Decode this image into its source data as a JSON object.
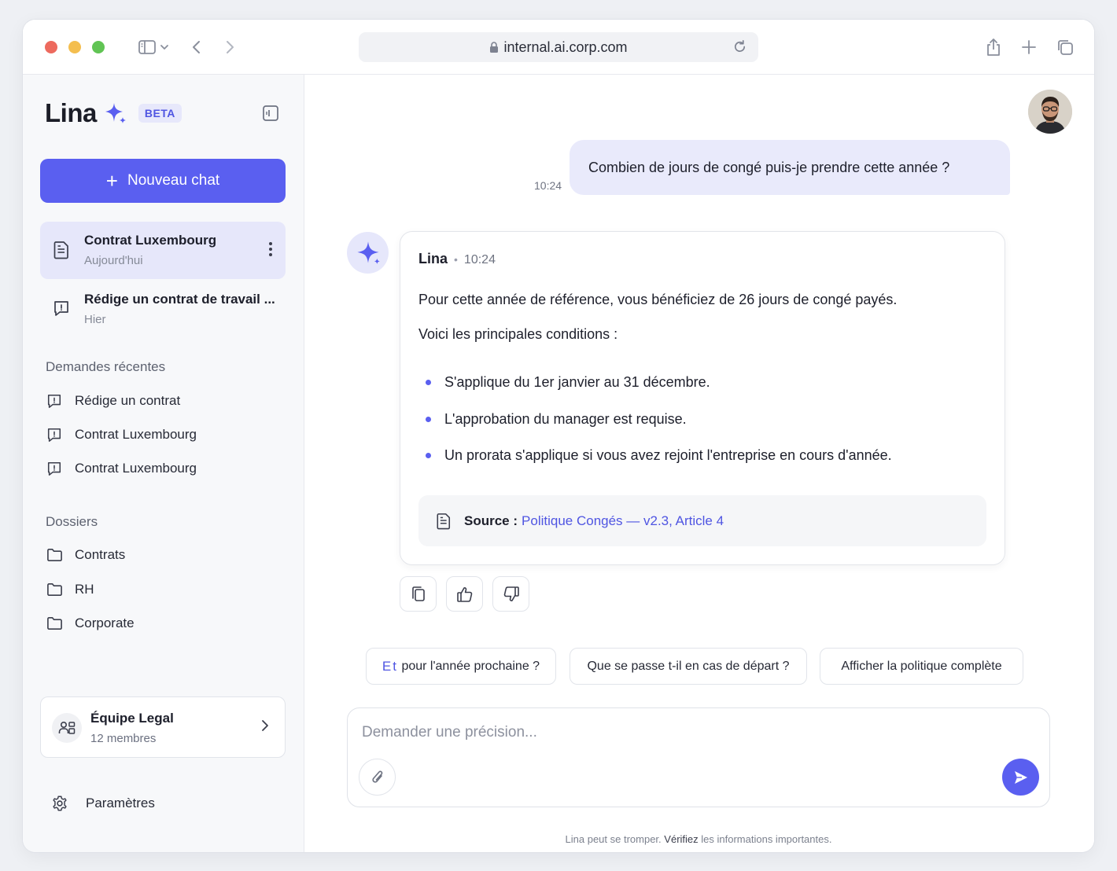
{
  "browser": {
    "url": "internal.ai.corp.com"
  },
  "sidebar": {
    "brand": "Lina",
    "badge": "BETA",
    "new_chat_label": "Nouveau chat",
    "conversations": [
      {
        "title": "Contrat Luxembourg",
        "subtitle": "Aujourd'hui"
      },
      {
        "title": "Rédige un contrat de travail ...",
        "subtitle": "Hier"
      }
    ],
    "recent_title": "Demandes récentes",
    "recent": [
      "Rédige un contrat",
      "Contrat Luxembourg",
      "Contrat Luxembourg"
    ],
    "folders_title": "Dossiers",
    "folders": [
      "Contrats",
      "RH",
      "Corporate"
    ],
    "team": {
      "name": "Équipe Legal",
      "members": "12 membres"
    },
    "settings_label": "Paramètres"
  },
  "chat": {
    "user_message": "Combien de jours de congé puis-je prendre cette année ?",
    "user_time": "10:24",
    "bot_name": "Lina",
    "bot_sep": "•",
    "bot_time": "10:24",
    "paragraphs": [
      "Pour cette année de référence, vous bénéficiez de 26 jours de congé payés.",
      "Voici les principales conditions :"
    ],
    "bullets": [
      "S'applique du 1er janvier au 31 décembre.",
      "L'approbation du manager est requise.",
      "Un prorata s'applique si vous avez rejoint l'entreprise en cours d'année."
    ],
    "source_label": "Source :",
    "source_link": "Politique Congés — v2.3, Article 4"
  },
  "suggestions": {
    "chip1_highlight": "Et",
    "chip1_rest": "pour l'année prochaine ?",
    "chip2": "Que se passe t-il en cas de départ ?",
    "chip3": "Afficher la politique complète"
  },
  "composer": {
    "placeholder": "Demander une précision...",
    "disclaimer_a": "Lina peut se tromper.",
    "disclaimer_b": "Vérifiez",
    "disclaimer_c": "les informations importantes."
  },
  "colors": {
    "accent": "#5a5ff0",
    "accent_text": "#4f55e2",
    "user_bubble": "#e9eafb"
  }
}
